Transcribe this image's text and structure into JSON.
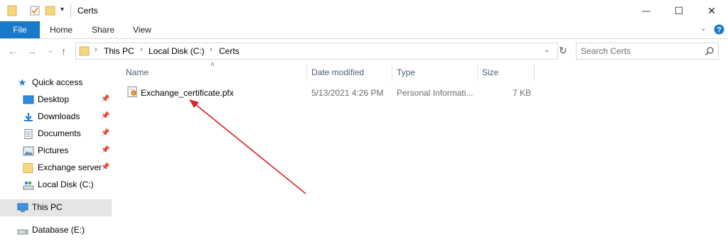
{
  "window": {
    "title": "Certs",
    "controls": {
      "minimize": "—",
      "maximize": "☐",
      "close": "✕"
    }
  },
  "ribbon": {
    "tabs": [
      {
        "label": "File",
        "active": true
      },
      {
        "label": "Home"
      },
      {
        "label": "Share"
      },
      {
        "label": "View"
      }
    ],
    "accent": "#1979ca"
  },
  "address": {
    "crumbs": [
      "This PC",
      "Local Disk (C:)",
      "Certs"
    ]
  },
  "search": {
    "placeholder": "Search Certs"
  },
  "sidebar": {
    "items": [
      {
        "label": "Quick access",
        "icon": "star-icon"
      },
      {
        "label": "Desktop",
        "icon": "desktop-icon",
        "pinned": true
      },
      {
        "label": "Downloads",
        "icon": "downloads-icon",
        "pinned": true
      },
      {
        "label": "Documents",
        "icon": "documents-icon",
        "pinned": true
      },
      {
        "label": "Pictures",
        "icon": "pictures-icon",
        "pinned": true
      },
      {
        "label": "Exchange server",
        "icon": "folder-icon",
        "pinned": true
      },
      {
        "label": "Local Disk (C:)",
        "icon": "drive-icon"
      },
      {
        "label": "This PC",
        "icon": "computer-icon",
        "selected": true
      },
      {
        "label": "Database (E:)",
        "icon": "drive-icon"
      }
    ]
  },
  "filelist": {
    "columns": [
      "Name",
      "Date modified",
      "Type",
      "Size"
    ],
    "rows": [
      {
        "name": "Exchange_certificate.pfx",
        "date": "5/13/2021 4:26 PM",
        "type": "Personal Informati...",
        "size": "7 KB",
        "icon": "certificate-file-icon"
      }
    ]
  },
  "annotation": {
    "color": "#e02020",
    "icon": "red-arrow"
  }
}
